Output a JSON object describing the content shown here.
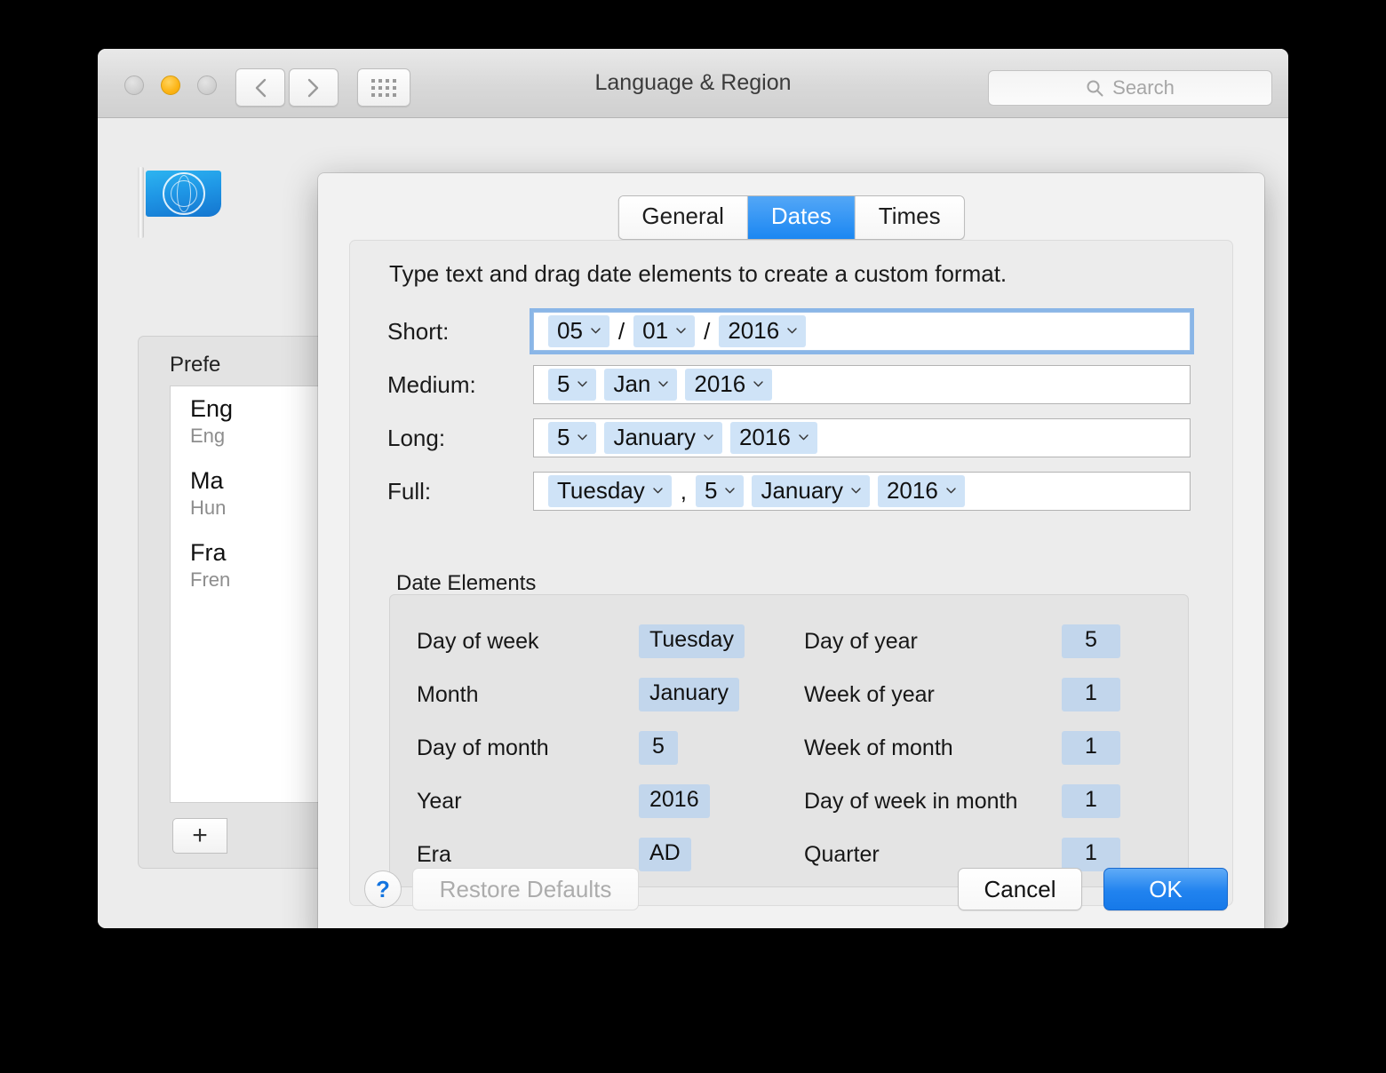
{
  "window": {
    "title": "Language & Region",
    "traffic_lights": [
      "close",
      "minimize",
      "zoom"
    ],
    "nav": {
      "back": "back-chevron",
      "forward": "forward-chevron",
      "show_all": "grid-icon"
    },
    "search": {
      "placeholder": "Search",
      "icon": "search-icon"
    }
  },
  "background": {
    "flag_icon": "un-flag-icon",
    "preferred_label": "Prefe",
    "languages": [
      {
        "name": "Eng",
        "sub": "Eng"
      },
      {
        "name": "Ma",
        "sub": "Hun"
      },
      {
        "name": "Fra",
        "sub": "Fren"
      }
    ],
    "add_button": "+",
    "help_button": "?"
  },
  "sheet": {
    "tabs": [
      {
        "label": "General",
        "active": false
      },
      {
        "label": "Dates",
        "active": true
      },
      {
        "label": "Times",
        "active": false
      }
    ],
    "intro": "Type text and drag date elements to create a custom format.",
    "formats": [
      {
        "label": "Short:",
        "focused": true,
        "parts": [
          {
            "kind": "token",
            "text": "05"
          },
          {
            "kind": "sep",
            "text": "/"
          },
          {
            "kind": "token",
            "text": "01"
          },
          {
            "kind": "sep",
            "text": "/"
          },
          {
            "kind": "token",
            "text": "2016"
          }
        ]
      },
      {
        "label": "Medium:",
        "focused": false,
        "parts": [
          {
            "kind": "token",
            "text": "5"
          },
          {
            "kind": "token",
            "text": "Jan"
          },
          {
            "kind": "token",
            "text": "2016"
          }
        ]
      },
      {
        "label": "Long:",
        "focused": false,
        "parts": [
          {
            "kind": "token",
            "text": "5"
          },
          {
            "kind": "token",
            "text": "January"
          },
          {
            "kind": "token",
            "text": "2016"
          }
        ]
      },
      {
        "label": "Full:",
        "focused": false,
        "parts": [
          {
            "kind": "token",
            "text": "Tuesday"
          },
          {
            "kind": "sep",
            "text": ","
          },
          {
            "kind": "token",
            "text": "5"
          },
          {
            "kind": "token",
            "text": "January"
          },
          {
            "kind": "token",
            "text": "2016"
          }
        ]
      }
    ],
    "date_elements": {
      "title": "Date Elements",
      "left": [
        {
          "name": "Day of week",
          "value": "Tuesday"
        },
        {
          "name": "Month",
          "value": "January"
        },
        {
          "name": "Day of month",
          "value": "5"
        },
        {
          "name": "Year",
          "value": "2016"
        },
        {
          "name": "Era",
          "value": "AD"
        }
      ],
      "right": [
        {
          "name": "Day of year",
          "value": "5"
        },
        {
          "name": "Week of year",
          "value": "1"
        },
        {
          "name": "Week of month",
          "value": "1"
        },
        {
          "name": "Day of week in month",
          "value": "1"
        },
        {
          "name": "Quarter",
          "value": "1"
        }
      ]
    },
    "footer": {
      "help": "?",
      "restore_defaults": "Restore Defaults",
      "cancel": "Cancel",
      "ok": "OK"
    }
  },
  "colors": {
    "accent_blue": "#1b87f2",
    "token_blue": "#cfe3f7",
    "element_token_blue": "#c2d6ec",
    "window_gray": "#ececec",
    "amber": "#fcb415"
  }
}
